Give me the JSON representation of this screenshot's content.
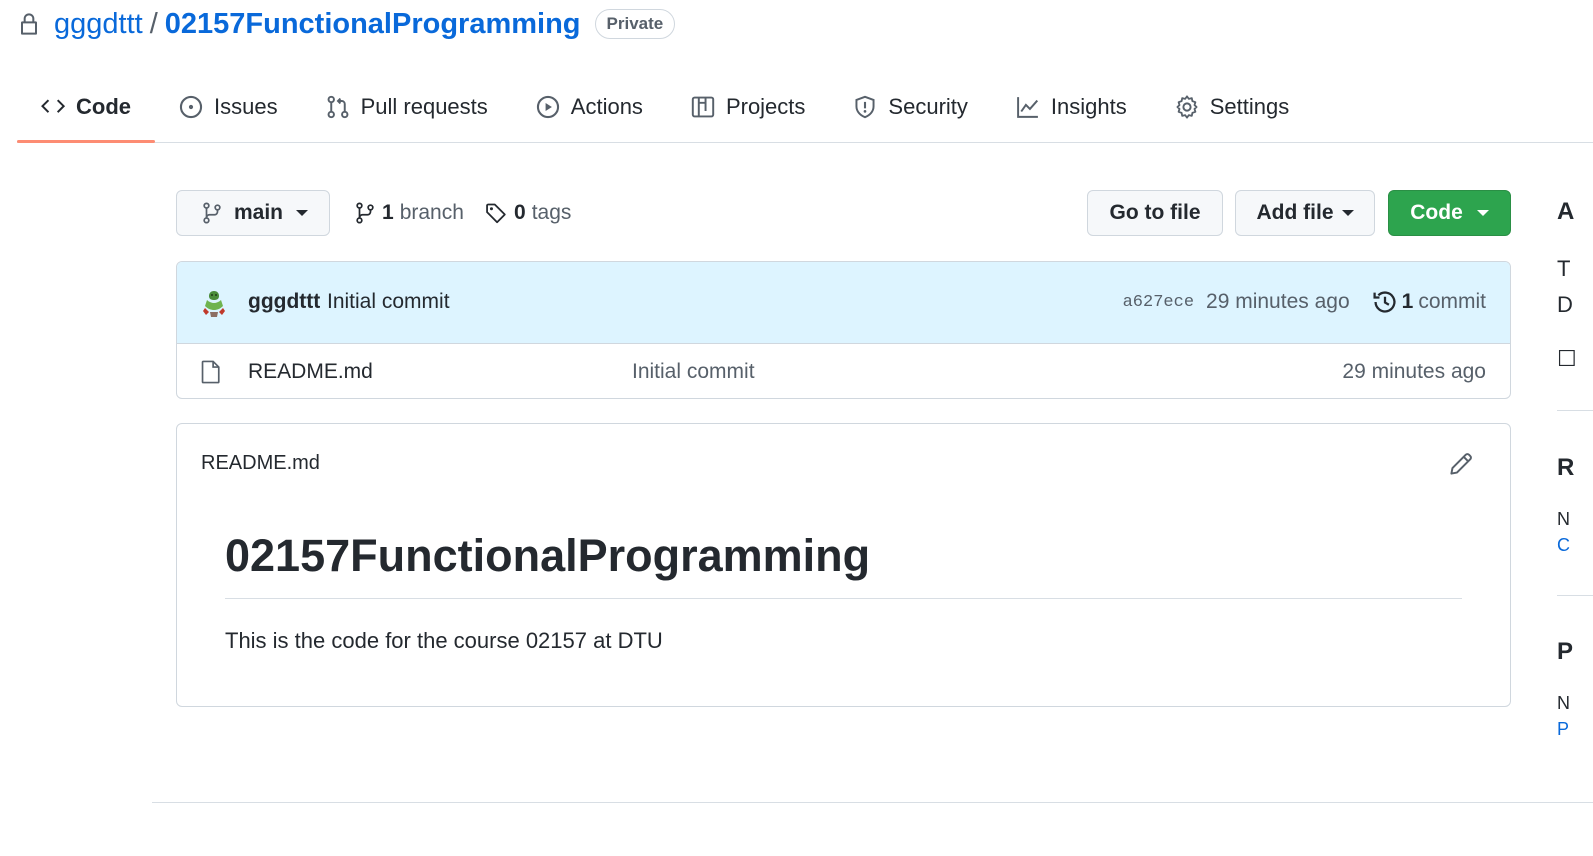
{
  "repo": {
    "owner": "gggdttt",
    "separator": "/",
    "name": "02157FunctionalProgramming",
    "visibility": "Private"
  },
  "tabs": [
    {
      "label": "Code",
      "icon": "code-icon",
      "selected": true
    },
    {
      "label": "Issues",
      "icon": "issue-opened-icon"
    },
    {
      "label": "Pull requests",
      "icon": "git-pull-request-icon"
    },
    {
      "label": "Actions",
      "icon": "play-icon"
    },
    {
      "label": "Projects",
      "icon": "table-icon"
    },
    {
      "label": "Security",
      "icon": "shield-icon"
    },
    {
      "label": "Insights",
      "icon": "graph-icon"
    },
    {
      "label": "Settings",
      "icon": "gear-icon"
    }
  ],
  "toolbar": {
    "branch": "main",
    "branch_count": "1",
    "branch_label": "branch",
    "tag_count": "0",
    "tag_label": "tags",
    "go_to_file": "Go to file",
    "add_file": "Add file",
    "code": "Code"
  },
  "latest_commit": {
    "author": "gggdttt",
    "message": "Initial commit",
    "sha": "a627ece",
    "time": "29 minutes ago",
    "commit_count": "1",
    "commit_label": "commit"
  },
  "files": [
    {
      "name": "README.md",
      "message": "Initial commit",
      "time": "29 minutes ago",
      "icon": "file-icon"
    }
  ],
  "readme": {
    "filename": "README.md",
    "heading": "02157FunctionalProgramming",
    "body": "This is the code for the course 02157 at DTU"
  },
  "sidebar_fragments": {
    "a": "A",
    "t": "T",
    "d": "D",
    "box": "☐",
    "r": "R",
    "n1": "N",
    "c": "C",
    "p_head": "P",
    "n2": "N",
    "p_link": "P"
  },
  "colors": {
    "accent": "#0969da",
    "tab_underline": "#fd8c73",
    "primary_button": "#2da44e",
    "commit_row_bg": "#ddf4ff"
  }
}
